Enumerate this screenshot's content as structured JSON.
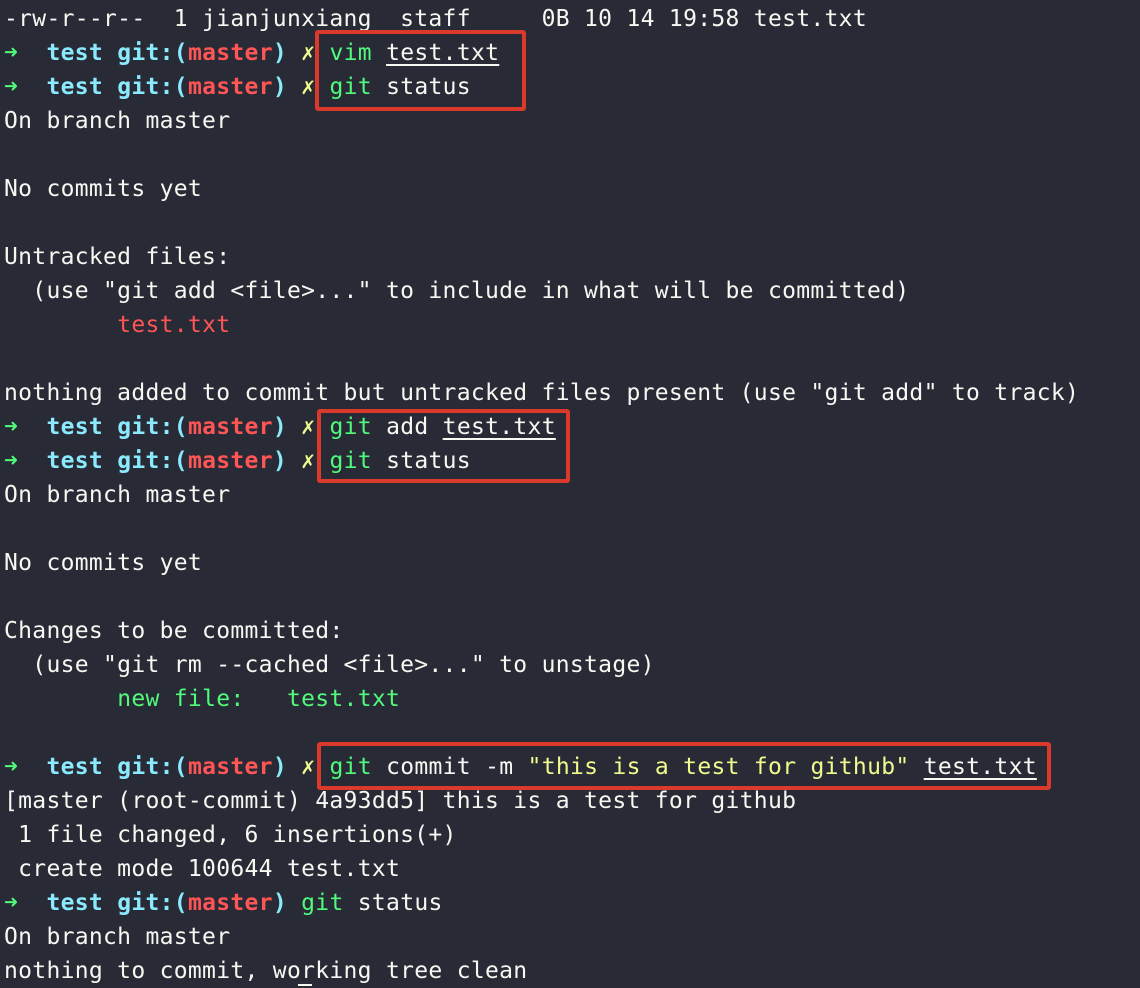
{
  "prompt": {
    "arrow": "➜",
    "dir": "test",
    "git_label": "git:",
    "paren_open": "(",
    "branch": "master",
    "paren_close": ")",
    "dirty": "✗"
  },
  "lines": {
    "l0": {
      "text": "-rw-r--r--  1 jianjunxiang  staff     0B 10 14 19:58 test.txt"
    },
    "l1": {
      "cmd": "vim",
      "sp": " ",
      "file": "test.txt"
    },
    "l2": {
      "cmd": "git",
      "rest": " status"
    },
    "l3": {
      "text": "On branch master"
    },
    "l5": {
      "text": "No commits yet"
    },
    "l7": {
      "text": "Untracked files:"
    },
    "l8": {
      "text": "  (use \"git add <file>...\" to include in what will be committed)"
    },
    "l9": {
      "indent": "        ",
      "file": "test.txt"
    },
    "l11": {
      "text": "nothing added to commit but untracked files present (use \"git add\" to track)"
    },
    "l12": {
      "cmd": "git",
      "rest": " add ",
      "file": "test.txt"
    },
    "l13": {
      "cmd": "git",
      "rest": " status"
    },
    "l14": {
      "text": "On branch master"
    },
    "l16": {
      "text": "No commits yet"
    },
    "l18": {
      "text": "Changes to be committed:"
    },
    "l19": {
      "text": "  (use \"git rm --cached <file>...\" to unstage)"
    },
    "l20": {
      "indent": "        ",
      "label": "new file:",
      "gap": "   ",
      "file": "test.txt"
    },
    "l22": {
      "cmd": "git",
      "rest": " commit -m ",
      "msg": "\"this is a test for github\"",
      "sp": " ",
      "file": "test.txt"
    },
    "l23": {
      "text": "[master (root-commit) 4a93dd5] this is a test for github"
    },
    "l24": {
      "text": " 1 file changed, 6 insertions(+)"
    },
    "l25": {
      "text": " create mode 100644 test.txt"
    },
    "l26": {
      "cmd": "git",
      "rest": " status"
    },
    "l27": {
      "text": "On branch master"
    },
    "l28": {
      "text": "nothing to commit, working tree clean"
    }
  },
  "colors": {
    "background": "#282a36",
    "foreground": "#f8f8f2",
    "prompt_arrow": "#50fa7b",
    "prompt_cyan": "#8be9fd",
    "branch_red": "#ff5555",
    "dirty_yellow": "#f1fa8c",
    "highlight_box": "#d93a2b"
  }
}
